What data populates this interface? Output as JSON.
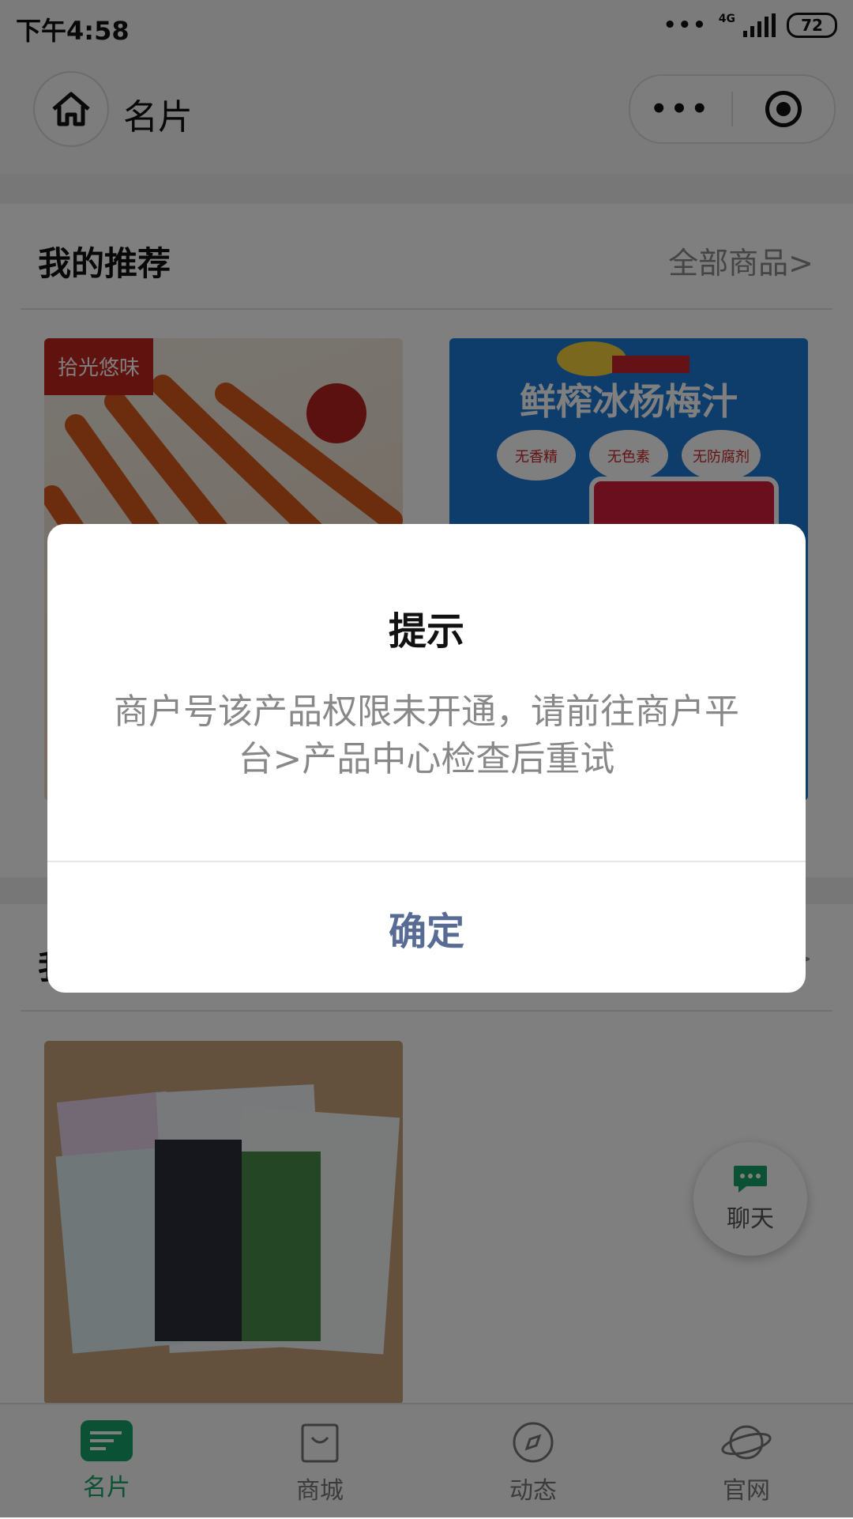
{
  "status": {
    "time": "下午4:58",
    "network": "4G",
    "battery": "72"
  },
  "nav": {
    "title": "名片",
    "more": "•••"
  },
  "section1": {
    "title": "我的推荐",
    "link": "全部商品>"
  },
  "section2": {
    "title": "我",
    "link": ">"
  },
  "products": [
    {
      "badge": "拾光悠味"
    },
    {
      "title": "鲜榨冰杨梅汁",
      "tags": [
        "无香精",
        "无色素",
        "无防腐剂"
      ]
    },
    {
      "badge": ""
    }
  ],
  "chat": {
    "label": "聊天"
  },
  "tabbar": [
    {
      "label": "名片",
      "icon": "card-icon",
      "active": true
    },
    {
      "label": "商城",
      "icon": "bag-icon"
    },
    {
      "label": "动态",
      "icon": "compass-icon"
    },
    {
      "label": "官网",
      "icon": "planet-icon"
    }
  ],
  "dialog": {
    "title": "提示",
    "message": "商户号该产品权限未开通，请前往商户平台>产品中心检查后重试",
    "confirm": "确定"
  },
  "colors": {
    "accent": "#16a36a",
    "dialog_button": "#576b95"
  }
}
